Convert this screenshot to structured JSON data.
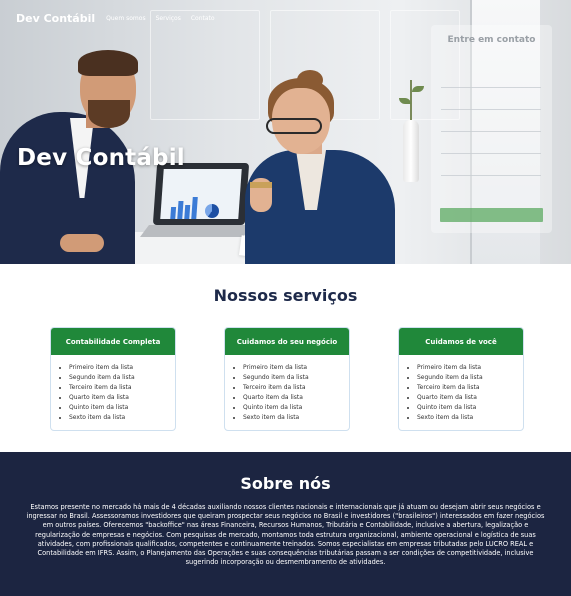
{
  "nav": {
    "logo": "Dev Contábil",
    "links": [
      "Quem somos",
      "Serviços",
      "Contato"
    ]
  },
  "hero": {
    "title": "Dev Contábil"
  },
  "contact": {
    "title": "Entre em contato"
  },
  "services": {
    "title": "Nossos serviços",
    "cards": [
      {
        "title": "Contabilidade Completa",
        "items": [
          "Primeiro item da lista",
          "Segundo item da lista",
          "Terceiro item da lista",
          "Quarto item da lista",
          "Quinto item da lista",
          "Sexto item da lista"
        ]
      },
      {
        "title": "Cuidamos do seu negócio",
        "items": [
          "Primeiro item da lista",
          "Segundo item da lista",
          "Terceiro item da lista",
          "Quarto item da lista",
          "Quinto item da lista",
          "Sexto item da lista"
        ]
      },
      {
        "title": "Cuidamos de você",
        "items": [
          "Primeiro item da lista",
          "Segundo item da lista",
          "Terceiro item da lista",
          "Quarto item da lista",
          "Quinto item da lista",
          "Sexto item da lista"
        ]
      }
    ]
  },
  "about": {
    "title": "Sobre nós",
    "text": "Estamos presente no mercado há mais de 4 décadas auxiliando nossos clientes nacionais e internacionais que já atuam ou desejam abrir seus negócios e ingressar no Brasil. Assessoramos investidores que queiram prospectar seus negócios no Brasil e investidores (\"brasileiros\") interessados em fazer negócios em outros países. Oferecemos \"backoffice\" nas áreas Financeira, Recursos Humanos, Tributária e Contabilidade, inclusive a abertura, legalização e regularização de empresas e negócios. Com pesquisas de mercado, montamos toda estrutura organizacional, ambiente operacional e logística de suas atividades, com profissionais qualificados, competentes e continuamente treinados. Somos especialistas em empresas tributadas pelo LUCRO REAL e Contabilidade em IFRS. Assim, o Planejamento das Operações e suas consequências tributárias passam a ser condições de competitividade, inclusive sugerindo incorporação ou desmembramento de atividades."
  },
  "colors": {
    "brand_navy": "#1c2541",
    "card_green": "#20883a",
    "title_navy": "#1e2a4a",
    "submit_green": "#5caa62"
  }
}
